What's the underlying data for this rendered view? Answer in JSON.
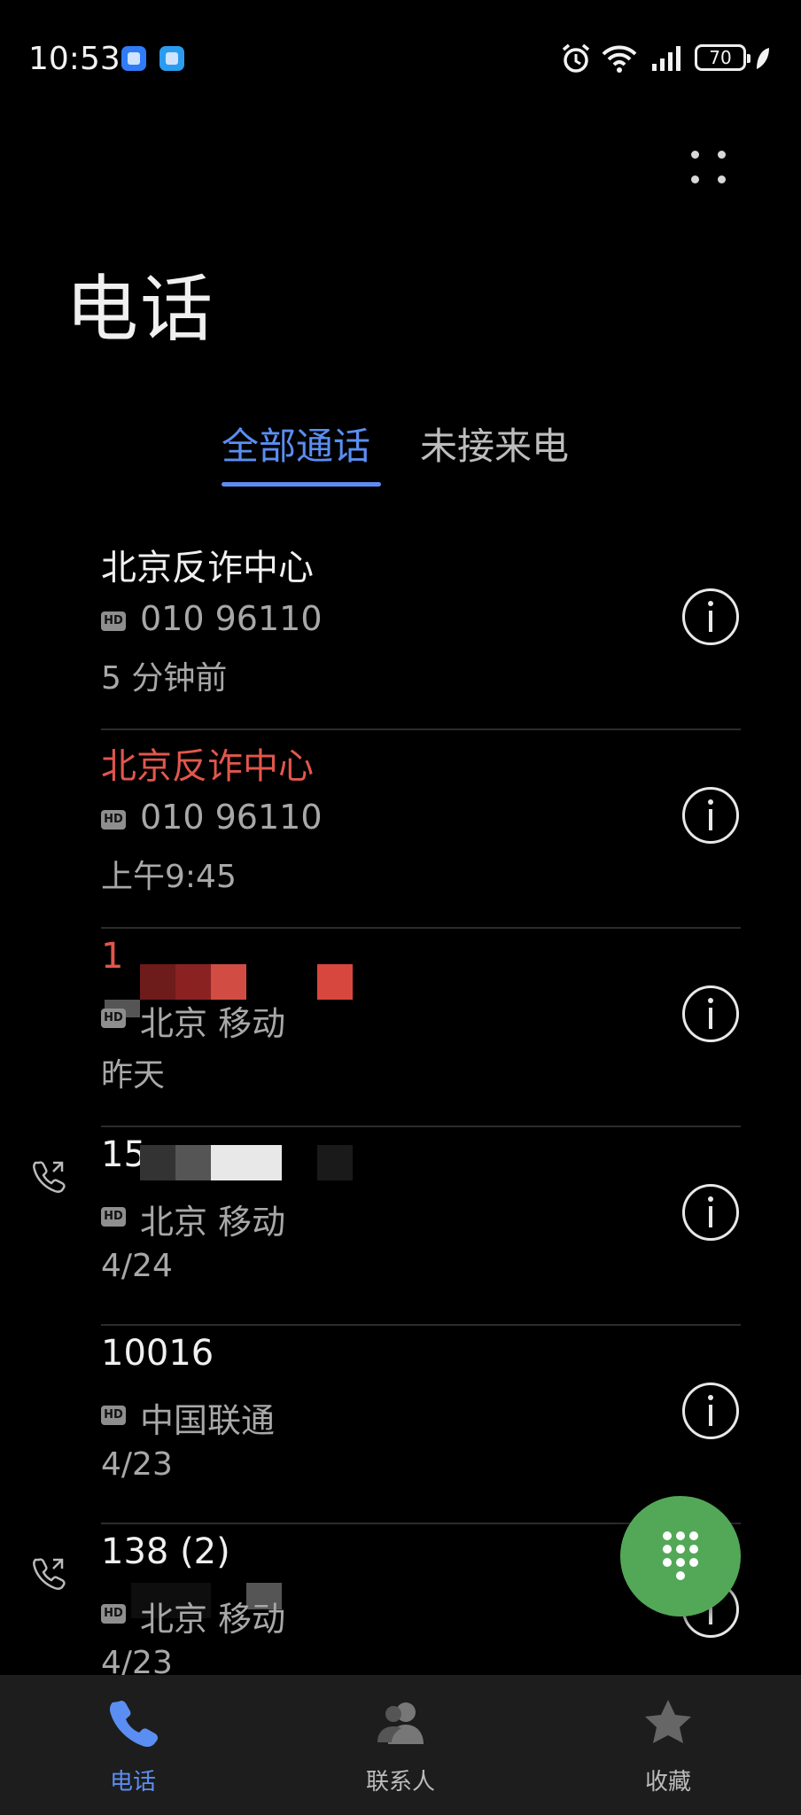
{
  "status_bar": {
    "time": "10:53",
    "battery": "70",
    "icons": [
      "app-icon-1",
      "app-icon-2",
      "alarm-icon",
      "wifi-icon",
      "signal-icon",
      "battery-icon",
      "leaf-icon"
    ]
  },
  "header": {
    "title": "电话"
  },
  "tabs": [
    {
      "label": "全部通话",
      "active": true
    },
    {
      "label": "未接来电",
      "active": false
    }
  ],
  "calls": [
    {
      "name": "北京反诈中心",
      "number": "010 96110",
      "time": "5 分钟前",
      "missed": false,
      "outgoing": false
    },
    {
      "name": "北京反诈中心",
      "number": "010 96110",
      "time": "上午9:45",
      "missed": true,
      "outgoing": false
    },
    {
      "name": "1",
      "number": "北京 移动",
      "time": "昨天",
      "missed": true,
      "outgoing": false
    },
    {
      "name": "15",
      "number": "北京 移动",
      "time": "4/24",
      "missed": false,
      "outgoing": true
    },
    {
      "name": "10016",
      "number": "中国联通",
      "time": "4/23",
      "missed": false,
      "outgoing": false
    },
    {
      "name": "138  (2)",
      "number": "北京 移动",
      "time": "4/23",
      "missed": false,
      "outgoing": true
    }
  ],
  "hd_label": "HD",
  "bottom_nav": [
    {
      "label": "电话",
      "active": true
    },
    {
      "label": "联系人",
      "active": false
    },
    {
      "label": "收藏",
      "active": false
    }
  ],
  "colors": {
    "accent": "#5b8ef2",
    "missed": "#e2564c",
    "fab": "#53a857",
    "background": "#000000"
  }
}
